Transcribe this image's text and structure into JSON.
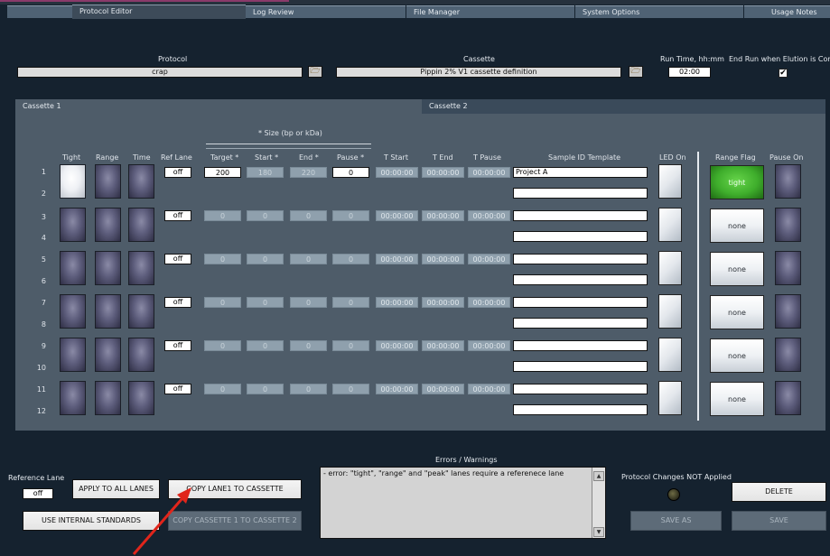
{
  "tabs": [
    {
      "label": "Protocol Editor",
      "active": true
    },
    {
      "label": "Log Review"
    },
    {
      "label": "File Manager"
    },
    {
      "label": "System Options"
    },
    {
      "label": "Usage Notes"
    }
  ],
  "protocol": {
    "label": "Protocol",
    "value": "crap"
  },
  "cassette": {
    "label": "Cassette",
    "value": "Pippin 2% V1 cassette definition"
  },
  "run_time": {
    "label": "Run Time, hh:mm",
    "value": "02:00"
  },
  "end_run": {
    "label": "End Run when Elution is Comp",
    "checked": true,
    "mark": "✔"
  },
  "cassette_tabs": [
    "Cassette 1",
    "Cassette 2"
  ],
  "size_header": "* Size (bp or kDa)",
  "columns": {
    "tight": "Tight",
    "range": "Range",
    "time": "Time",
    "ref_lane": "Ref Lane",
    "target": "Target *",
    "start": "Start *",
    "end": "End *",
    "pause": "Pause *",
    "t_start": "T Start",
    "t_end": "T End",
    "t_pause": "T Pause",
    "sample_id": "Sample ID Template",
    "led_on": "LED On",
    "range_flag": "Range Flag",
    "pause_on": "Pause On"
  },
  "lanes": [
    "1",
    "2",
    "3",
    "4",
    "5",
    "6",
    "7",
    "8",
    "9",
    "10",
    "11",
    "12"
  ],
  "rows": [
    {
      "ref": "off",
      "target": "200",
      "start": "180",
      "end": "220",
      "pause": "0",
      "t_start": "00:00:00",
      "t_end": "00:00:00",
      "t_pause": "00:00:00",
      "sample_a": "Project A",
      "sample_b": "",
      "flag": "tight"
    },
    {
      "ref": "off",
      "target": "0",
      "start": "0",
      "end": "0",
      "pause": "0",
      "t_start": "00:00:00",
      "t_end": "00:00:00",
      "t_pause": "00:00:00",
      "sample_a": "",
      "sample_b": "",
      "flag": "none"
    },
    {
      "ref": "off",
      "target": "0",
      "start": "0",
      "end": "0",
      "pause": "0",
      "t_start": "00:00:00",
      "t_end": "00:00:00",
      "t_pause": "00:00:00",
      "sample_a": "",
      "sample_b": "",
      "flag": "none"
    },
    {
      "ref": "off",
      "target": "0",
      "start": "0",
      "end": "0",
      "pause": "0",
      "t_start": "00:00:00",
      "t_end": "00:00:00",
      "t_pause": "00:00:00",
      "sample_a": "",
      "sample_b": "",
      "flag": "none"
    },
    {
      "ref": "off",
      "target": "0",
      "start": "0",
      "end": "0",
      "pause": "0",
      "t_start": "00:00:00",
      "t_end": "00:00:00",
      "t_pause": "00:00:00",
      "sample_a": "",
      "sample_b": "",
      "flag": "none"
    },
    {
      "ref": "off",
      "target": "0",
      "start": "0",
      "end": "0",
      "pause": "0",
      "t_start": "00:00:00",
      "t_end": "00:00:00",
      "t_pause": "00:00:00",
      "sample_a": "",
      "sample_b": "",
      "flag": "none"
    }
  ],
  "reference_lane": {
    "label": "Reference Lane",
    "value": "off"
  },
  "buttons": {
    "apply_all": "APPLY TO ALL LANES",
    "copy_lane1": "COPY LANE1 TO CASSETTE",
    "use_internal": "USE INTERNAL STANDARDS",
    "copy_cassette": "COPY CASSETTE 1 TO CASSETTE 2",
    "delete": "DELETE",
    "save_as": "SAVE AS",
    "save": "SAVE"
  },
  "errors": {
    "label": "Errors / Warnings",
    "text": "- error: \"tight\", \"range\" and \"peak\" lanes require a referenece lane"
  },
  "protocol_changes": "Protocol Changes NOT Applied",
  "colors": {
    "accent_green": "#3fae2c",
    "panel": "#4e5c69",
    "background": "#15222f",
    "arrow": "#e0251b"
  }
}
